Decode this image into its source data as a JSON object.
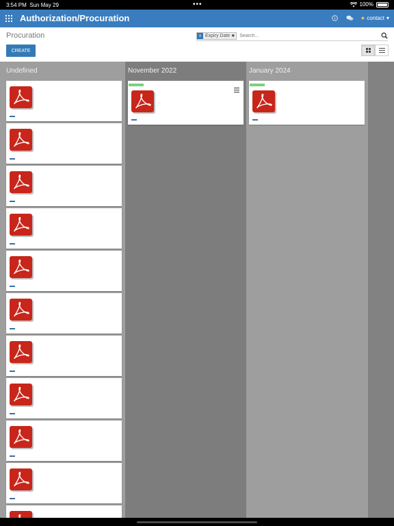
{
  "statusbar": {
    "time": "3:54 PM",
    "date": "Sun May 29",
    "battery": "100%"
  },
  "navbar": {
    "title": "Authorization/Procuration",
    "user": "contact"
  },
  "control": {
    "breadcrumb": "Procuration",
    "create_label": "CREATE",
    "facet_label": "Expiry Date",
    "search_placeholder": "Search..."
  },
  "columns": [
    {
      "title": "Undefined",
      "card_count": 11
    },
    {
      "title": "November 2022",
      "card_count": 1
    },
    {
      "title": "January 2024",
      "card_count": 1
    }
  ],
  "icons": {
    "apps": "grid-icon",
    "help": "info-icon",
    "messages": "chat-icon",
    "user": "lightbulb-icon",
    "search": "search-icon",
    "pdf": "pdf-icon",
    "kanban_view": "kanban-view-icon",
    "list_view": "list-view-icon",
    "card_menu": "hamburger-menu-icon"
  },
  "colors": {
    "navbar": "#3a7dbf",
    "button": "#337ab7",
    "pdf": "#c8261b",
    "tag": "#7ed07e"
  }
}
